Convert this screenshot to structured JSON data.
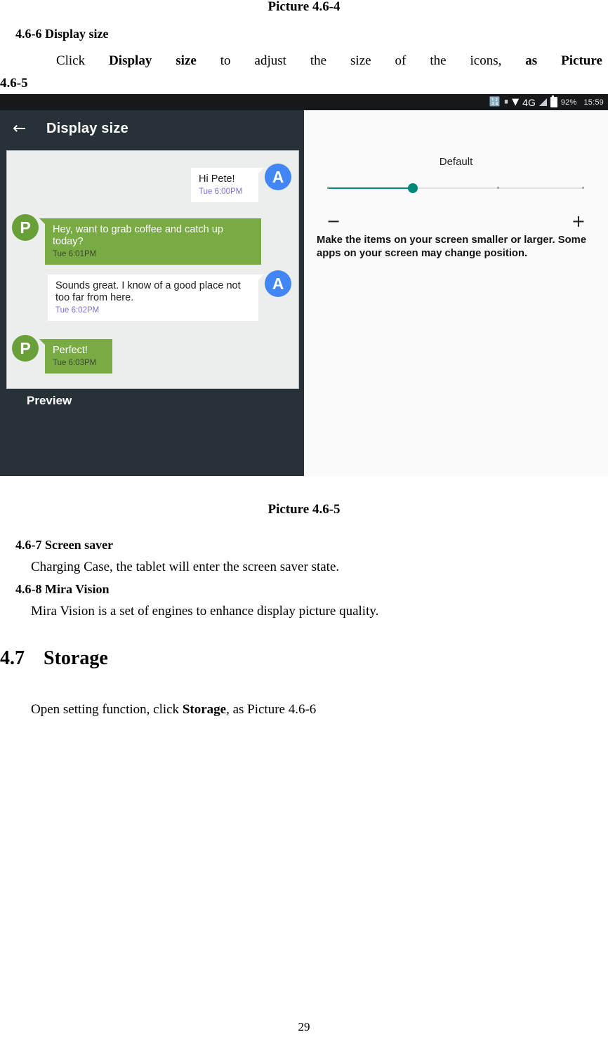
{
  "document": {
    "caption_top": "Picture 4.6-4",
    "section_466_heading": "4.6-6 Display size",
    "para_click": {
      "w1": "Click",
      "w2": "Display",
      "w3": "size",
      "w4": "to",
      "w5": "adjust",
      "w6": "the",
      "w7": "size",
      "w8": "of",
      "w9": "the",
      "w10": "icons,",
      "w11": "as",
      "w12": "Picture",
      "w13": "4.6-5"
    },
    "caption_bottom": "Picture 4.6-5",
    "section_467_heading": "4.6-7 Screen saver",
    "section_467_body": "Charging Case, the tablet will enter the screen saver state.",
    "section_468_heading": "4.6-8 Mira Vision",
    "section_468_body": "Mira Vision is a set of engines to enhance display picture quality.",
    "section_47_number": "4.7",
    "section_47_title": "Storage",
    "section_47_body_pre": "Open setting function, click ",
    "section_47_body_bold": "Storage",
    "section_47_body_post": ", as Picture 4.6-6",
    "page_number": "29"
  },
  "screenshot": {
    "statusbar": {
      "bluetooth_icon": "bluetooth-icon",
      "vibrate_icon": "vibrate-icon",
      "wifi_icon": "wifi-icon",
      "network_label": "4G",
      "signal_icon": "signal-bars-icon",
      "battery_icon": "battery-icon",
      "battery_percent": "92%",
      "clock": "15:59",
      "bg_color": "#16191c"
    },
    "toolbar": {
      "back_icon": "←",
      "title": "Display size",
      "bg_color": "#263238"
    },
    "preview": {
      "label": "Preview",
      "messages": [
        {
          "side": "right",
          "avatar": "A",
          "avatar_color": "#4285f4",
          "text": "Hi Pete!",
          "time": "Tue 6:00PM",
          "bubble": "white"
        },
        {
          "side": "left",
          "avatar": "P",
          "avatar_color": "#689f38",
          "text": "Hey, want to grab coffee and catch up today?",
          "time": "Tue 6:01PM",
          "bubble": "green"
        },
        {
          "side": "right",
          "avatar": "A",
          "avatar_color": "#4285f4",
          "text": "Sounds great. I know of a good place not too far from here.",
          "time": "Tue 6:02PM",
          "bubble": "white"
        },
        {
          "side": "left",
          "avatar": "P",
          "avatar_color": "#689f38",
          "text": "Perfect!",
          "time": "Tue 6:03PM",
          "bubble": "green"
        }
      ]
    },
    "settings": {
      "size_label": "Default",
      "slider": {
        "steps": 4,
        "selected_index": 1,
        "accent_color": "#00897b"
      },
      "decrease_label": "−",
      "increase_label": "+",
      "description": "Make the items on your screen smaller or larger. Some apps on your screen may change position."
    },
    "page_dots": {
      "count": 3,
      "active_index": 0,
      "active_color": "#00a192"
    },
    "navbar": {
      "back": "nav-back-icon",
      "home": "nav-home-icon",
      "recents": "nav-recents-icon"
    }
  }
}
